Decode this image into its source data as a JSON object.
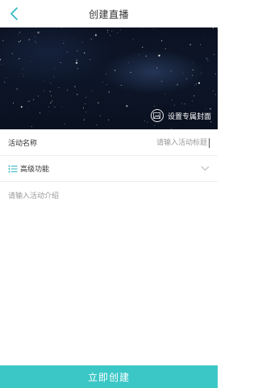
{
  "nav": {
    "title": "创建直播"
  },
  "cover": {
    "button_label": "设置专属封面",
    "icon": "image-icon"
  },
  "form": {
    "name_label": "活动名称",
    "name_placeholder": "请输入活动标题",
    "name_value": "",
    "advanced_label": "高级功能",
    "intro_placeholder": "请输入活动介绍",
    "intro_value": ""
  },
  "submit": {
    "label": "立即创建"
  },
  "colors": {
    "accent": "#3cc7c7",
    "back_arrow": "#2bb6c2"
  }
}
